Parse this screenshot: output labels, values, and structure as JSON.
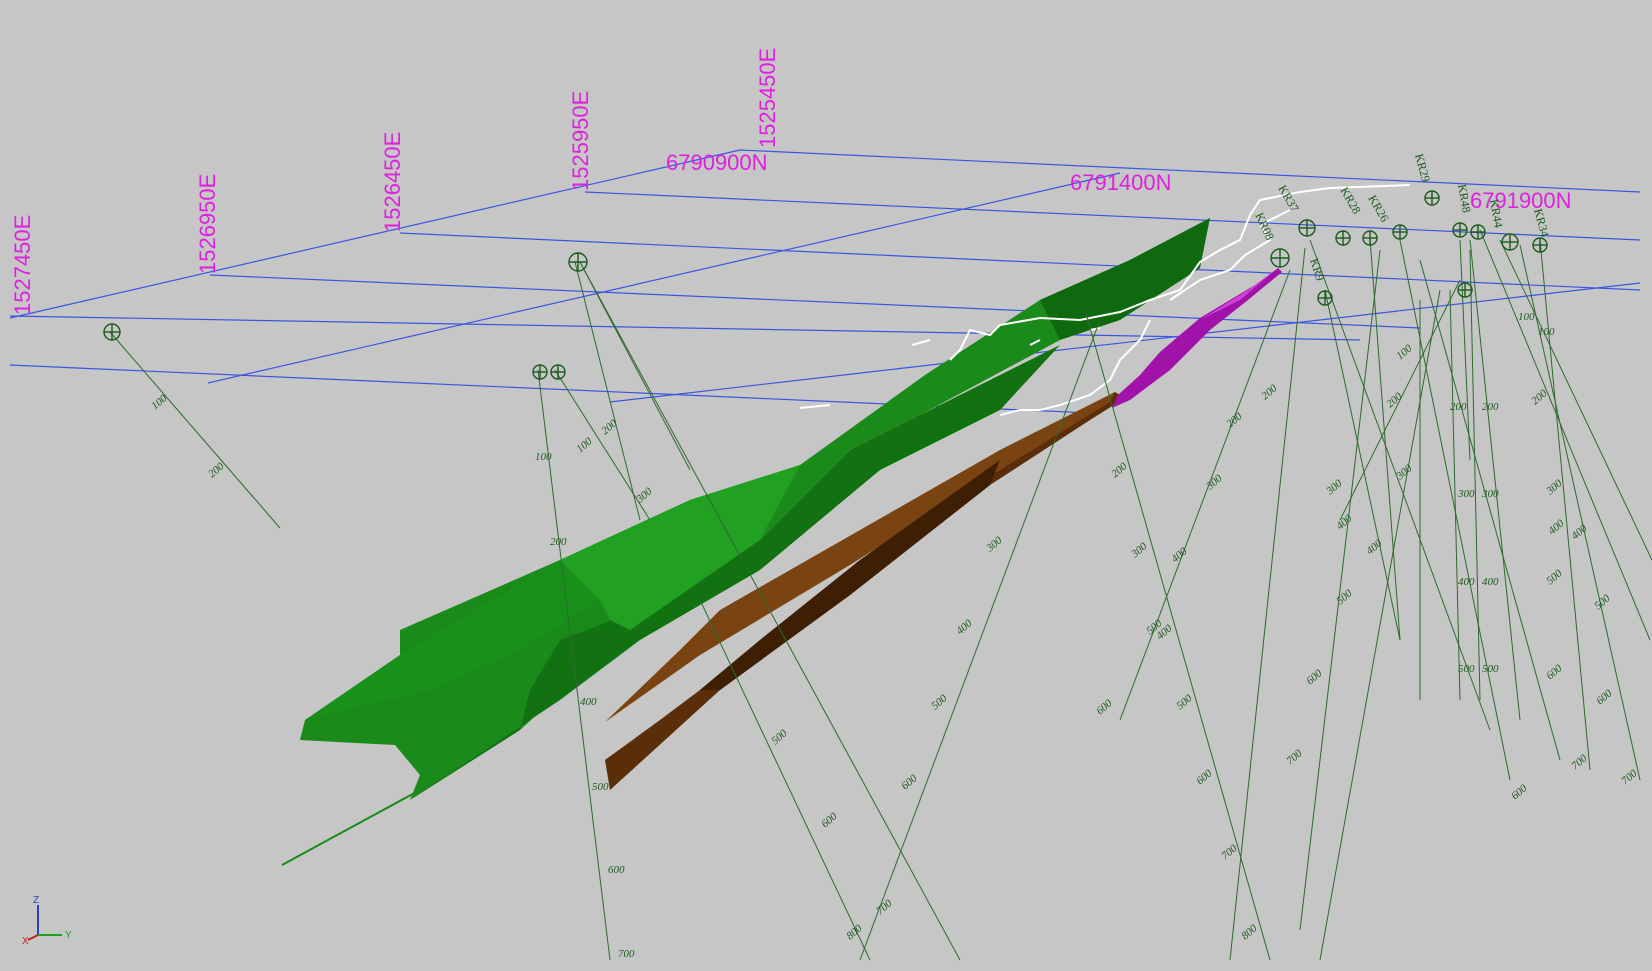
{
  "grid": {
    "easting_labels": [
      "1527450E",
      "1526950E",
      "1526450E",
      "1525950E",
      "1525450E"
    ],
    "northing_labels": [
      "6790900N",
      "6791400N",
      "6791900N"
    ]
  },
  "holes": {
    "names": [
      "KR37",
      "KR29",
      "KR26",
      "KR48",
      "KR34",
      "KR28",
      "KR9",
      "KR08",
      "KR44"
    ],
    "depth_ticks": [
      "100",
      "200",
      "300",
      "400",
      "500",
      "600",
      "700",
      "800"
    ]
  },
  "orientation": {
    "z": "Z",
    "x": "X",
    "y": "Y"
  },
  "colors": {
    "background": "#c6c6c6",
    "grid": "#3a56e0",
    "coordinate_text": "#e020e0",
    "drillhole": "#2e6a2e",
    "green_body": "#1f8a1f",
    "brown_body": "#5a2e08",
    "magenta_body": "#a012a8",
    "trace": "#ffffff"
  }
}
